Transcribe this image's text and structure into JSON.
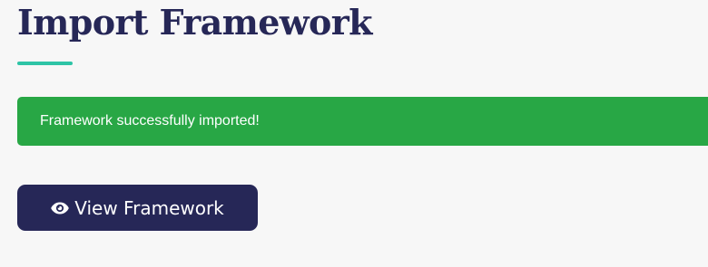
{
  "page": {
    "title": "Import Framework"
  },
  "alert": {
    "message": "Framework successfully imported!",
    "color": "#28a745"
  },
  "actions": {
    "view_framework_label": "View Framework",
    "view_framework_icon": "eye-icon",
    "button_color": "#262757"
  },
  "colors": {
    "title": "#262757",
    "accent": "#2ec4a6",
    "background": "#f7f7f7"
  }
}
